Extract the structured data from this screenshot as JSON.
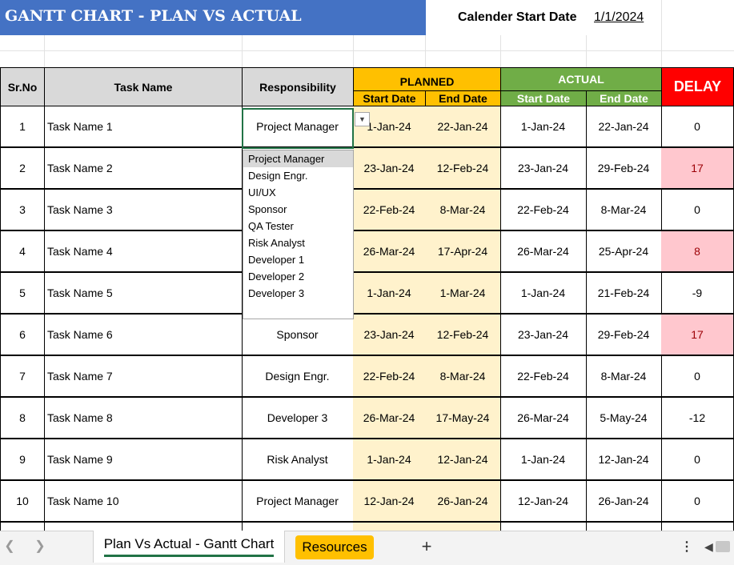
{
  "title": "GANTT CHART - PLAN VS ACTUAL",
  "calendar": {
    "label": "Calender Start Date",
    "value": "1/1/2024"
  },
  "headers": {
    "sr": "Sr.No",
    "task": "Task Name",
    "resp": "Responsibility",
    "planned": "PLANNED",
    "actual": "ACTUAL",
    "delay": "DELAY",
    "start": "Start Date",
    "end": "End Date"
  },
  "rows": [
    {
      "sr": "1",
      "task": "Task Name 1",
      "resp": "Project Manager",
      "ps": "1-Jan-24",
      "pe": "22-Jan-24",
      "as": "1-Jan-24",
      "ae": "22-Jan-24",
      "delay": "0",
      "pos": false
    },
    {
      "sr": "2",
      "task": "Task Name 2",
      "resp": "",
      "ps": "23-Jan-24",
      "pe": "12-Feb-24",
      "as": "23-Jan-24",
      "ae": "29-Feb-24",
      "delay": "17",
      "pos": true
    },
    {
      "sr": "3",
      "task": "Task Name 3",
      "resp": "",
      "ps": "22-Feb-24",
      "pe": "8-Mar-24",
      "as": "22-Feb-24",
      "ae": "8-Mar-24",
      "delay": "0",
      "pos": false
    },
    {
      "sr": "4",
      "task": "Task Name 4",
      "resp": "",
      "ps": "26-Mar-24",
      "pe": "17-Apr-24",
      "as": "26-Mar-24",
      "ae": "25-Apr-24",
      "delay": "8",
      "pos": true
    },
    {
      "sr": "5",
      "task": "Task Name 5",
      "resp": "",
      "ps": "1-Jan-24",
      "pe": "1-Mar-24",
      "as": "1-Jan-24",
      "ae": "21-Feb-24",
      "delay": "-9",
      "pos": false
    },
    {
      "sr": "6",
      "task": "Task Name 6",
      "resp": "Sponsor",
      "ps": "23-Jan-24",
      "pe": "12-Feb-24",
      "as": "23-Jan-24",
      "ae": "29-Feb-24",
      "delay": "17",
      "pos": true
    },
    {
      "sr": "7",
      "task": "Task Name 7",
      "resp": "Design Engr.",
      "ps": "22-Feb-24",
      "pe": "8-Mar-24",
      "as": "22-Feb-24",
      "ae": "8-Mar-24",
      "delay": "0",
      "pos": false
    },
    {
      "sr": "8",
      "task": "Task Name 8",
      "resp": "Developer 3",
      "ps": "26-Mar-24",
      "pe": "17-May-24",
      "as": "26-Mar-24",
      "ae": "5-May-24",
      "delay": "-12",
      "pos": false
    },
    {
      "sr": "9",
      "task": "Task Name 9",
      "resp": "Risk Analyst",
      "ps": "1-Jan-24",
      "pe": "12-Jan-24",
      "as": "1-Jan-24",
      "ae": "12-Jan-24",
      "delay": "0",
      "pos": false
    },
    {
      "sr": "10",
      "task": "Task Name 10",
      "resp": "Project Manager",
      "ps": "12-Jan-24",
      "pe": "26-Jan-24",
      "as": "12-Jan-24",
      "ae": "26-Jan-24",
      "delay": "0",
      "pos": false
    },
    {
      "sr": "",
      "task": "",
      "resp": "",
      "ps": "",
      "pe": "",
      "as": "",
      "ae": "",
      "delay": "",
      "pos": false
    }
  ],
  "dropdown": {
    "options": [
      "Project Manager",
      "Design Engr.",
      "UI/UX",
      "Sponsor",
      "QA Tester",
      "Risk Analyst",
      "Developer 1",
      "Developer 2",
      "Developer 3"
    ],
    "selected": "Project Manager"
  },
  "sheets": {
    "active": "Plan Vs Actual - Gantt Chart",
    "other": "Resources"
  },
  "colors": {
    "title_bg": "#4472C4",
    "planned_bg": "#FFC000",
    "actual_bg": "#70AD47",
    "delay_bg": "#FF0000",
    "plan_cell_bg": "#FFF2CC",
    "delay_positive_bg": "#FFC7CE"
  }
}
